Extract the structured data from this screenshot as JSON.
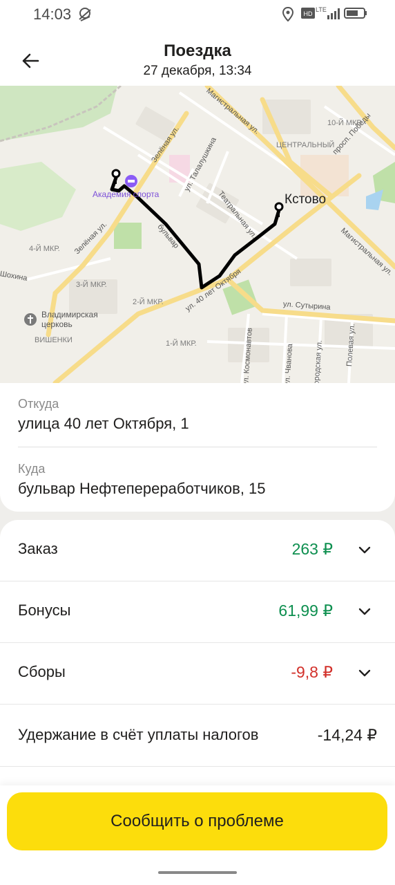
{
  "status_bar": {
    "time": "14:03",
    "network": "LTE"
  },
  "header": {
    "title": "Поездка",
    "subtitle": "27 декабря, 13:34"
  },
  "map": {
    "labels": {
      "poi": "Академия спорта",
      "city": "Кстово",
      "district_center": "ЦЕНТРАЛЬНЫЙ",
      "mkr10": "10-Й МКР.",
      "mkr4": "4-Й МКР.",
      "mkr3": "3-Й МКР.",
      "mkr2": "2-Й МКР.",
      "mkr1": "1-Й МКР.",
      "church": "Владимирская церковь",
      "vishenki": "ВИШЕНКИ",
      "shokhina": "Шохина"
    },
    "streets": {
      "magistral_top": "Магистральная ул.",
      "magistral_right": "Магистральная ул.",
      "zelenaya_top": "Зелёная ул.",
      "zelenaya_left": "Зелёная ул.",
      "talalushkina": "ул. Талалушкина",
      "teatralnaya": "Театральная ул.",
      "bulvar": "бульвар",
      "oktyabrya": "ул. 40 лет Октября",
      "pobedy": "просп. Победы",
      "sutyrina": "ул. Сутырина",
      "kosmonavtov": "ул. Космонавтов",
      "chvanova": "ул. Чванова",
      "gorodskaya": "Городская ул.",
      "polevaya": "Полевая ул."
    }
  },
  "route": {
    "from_caption": "Откуда",
    "from": "улица 40 лет Октября, 1",
    "to_caption": "Куда",
    "to": "бульвар Нефтепереработчиков, 15"
  },
  "payments": {
    "order": {
      "label": "Заказ",
      "amount": "263 ₽"
    },
    "bonuses": {
      "label": "Бонусы",
      "amount": "61,99 ₽"
    },
    "fees": {
      "label": "Сборы",
      "amount": "-9,8 ₽"
    },
    "tax": {
      "label": "Удержание в счёт уплаты налогов",
      "amount": "-14,24 ₽"
    }
  },
  "actions": {
    "report_label": "Сообщить о проблеме"
  },
  "colors": {
    "accent": "#fcdd0c",
    "positive": "#0d8f4f",
    "negative": "#d2302a",
    "route": "#000000"
  }
}
